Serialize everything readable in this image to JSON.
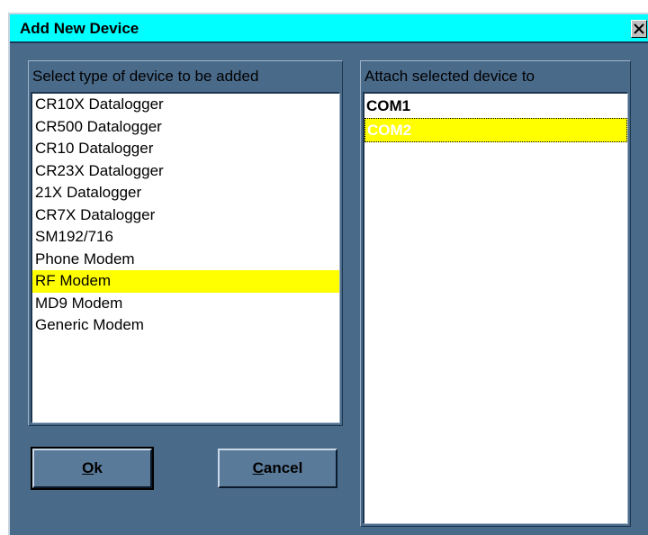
{
  "window": {
    "title": "Add New Device",
    "close_glyph": "✕"
  },
  "device_types": {
    "header": "Select type of device to be added",
    "items": [
      "CR10X Datalogger",
      "CR500 Datalogger",
      "CR10 Datalogger",
      "CR23X Datalogger",
      "21X Datalogger",
      "CR7X Datalogger",
      "SM192/716",
      "Phone Modem",
      "RF Modem",
      "MD9 Modem",
      "Generic Modem"
    ],
    "selected": "RF Modem"
  },
  "attach_to": {
    "header": "Attach selected device to",
    "items": [
      "COM1",
      "COM2"
    ],
    "selected": "COM2"
  },
  "buttons": {
    "ok": {
      "accel": "O",
      "rest": "k"
    },
    "cancel": {
      "accel": "C",
      "rest": "ancel"
    }
  },
  "colors": {
    "title_bar": "#00ffff",
    "dialog_face": "#4a6a8a",
    "selection": "#ffff00"
  }
}
